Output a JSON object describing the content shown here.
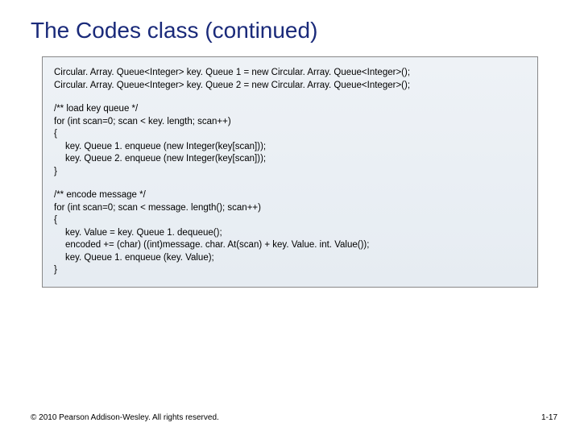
{
  "title": "The Codes class (continued)",
  "code": {
    "decl1": "Circular. Array. Queue<Integer> key. Queue 1 = new Circular. Array. Queue<Integer>();",
    "decl2": "Circular. Array. Queue<Integer> key. Queue 2 = new Circular. Array. Queue<Integer>();",
    "c1": "/** load key queue */",
    "c2": "for (int scan=0; scan < key. length; scan++)",
    "c3": "{",
    "c4": "key. Queue 1. enqueue (new Integer(key[scan]));",
    "c5": "key. Queue 2. enqueue (new Integer(key[scan]));",
    "c6": "}",
    "d1": "/** encode message */",
    "d2": "for (int scan=0; scan < message. length(); scan++)",
    "d3": "{",
    "d4": "key. Value = key. Queue 1. dequeue();",
    "d5": "encoded += (char) ((int)message. char. At(scan) + key. Value. int. Value());",
    "d6": "key. Queue 1. enqueue (key. Value);",
    "d7": "}"
  },
  "footer": "© 2010 Pearson Addison-Wesley. All rights reserved.",
  "pagenum": "1-17"
}
